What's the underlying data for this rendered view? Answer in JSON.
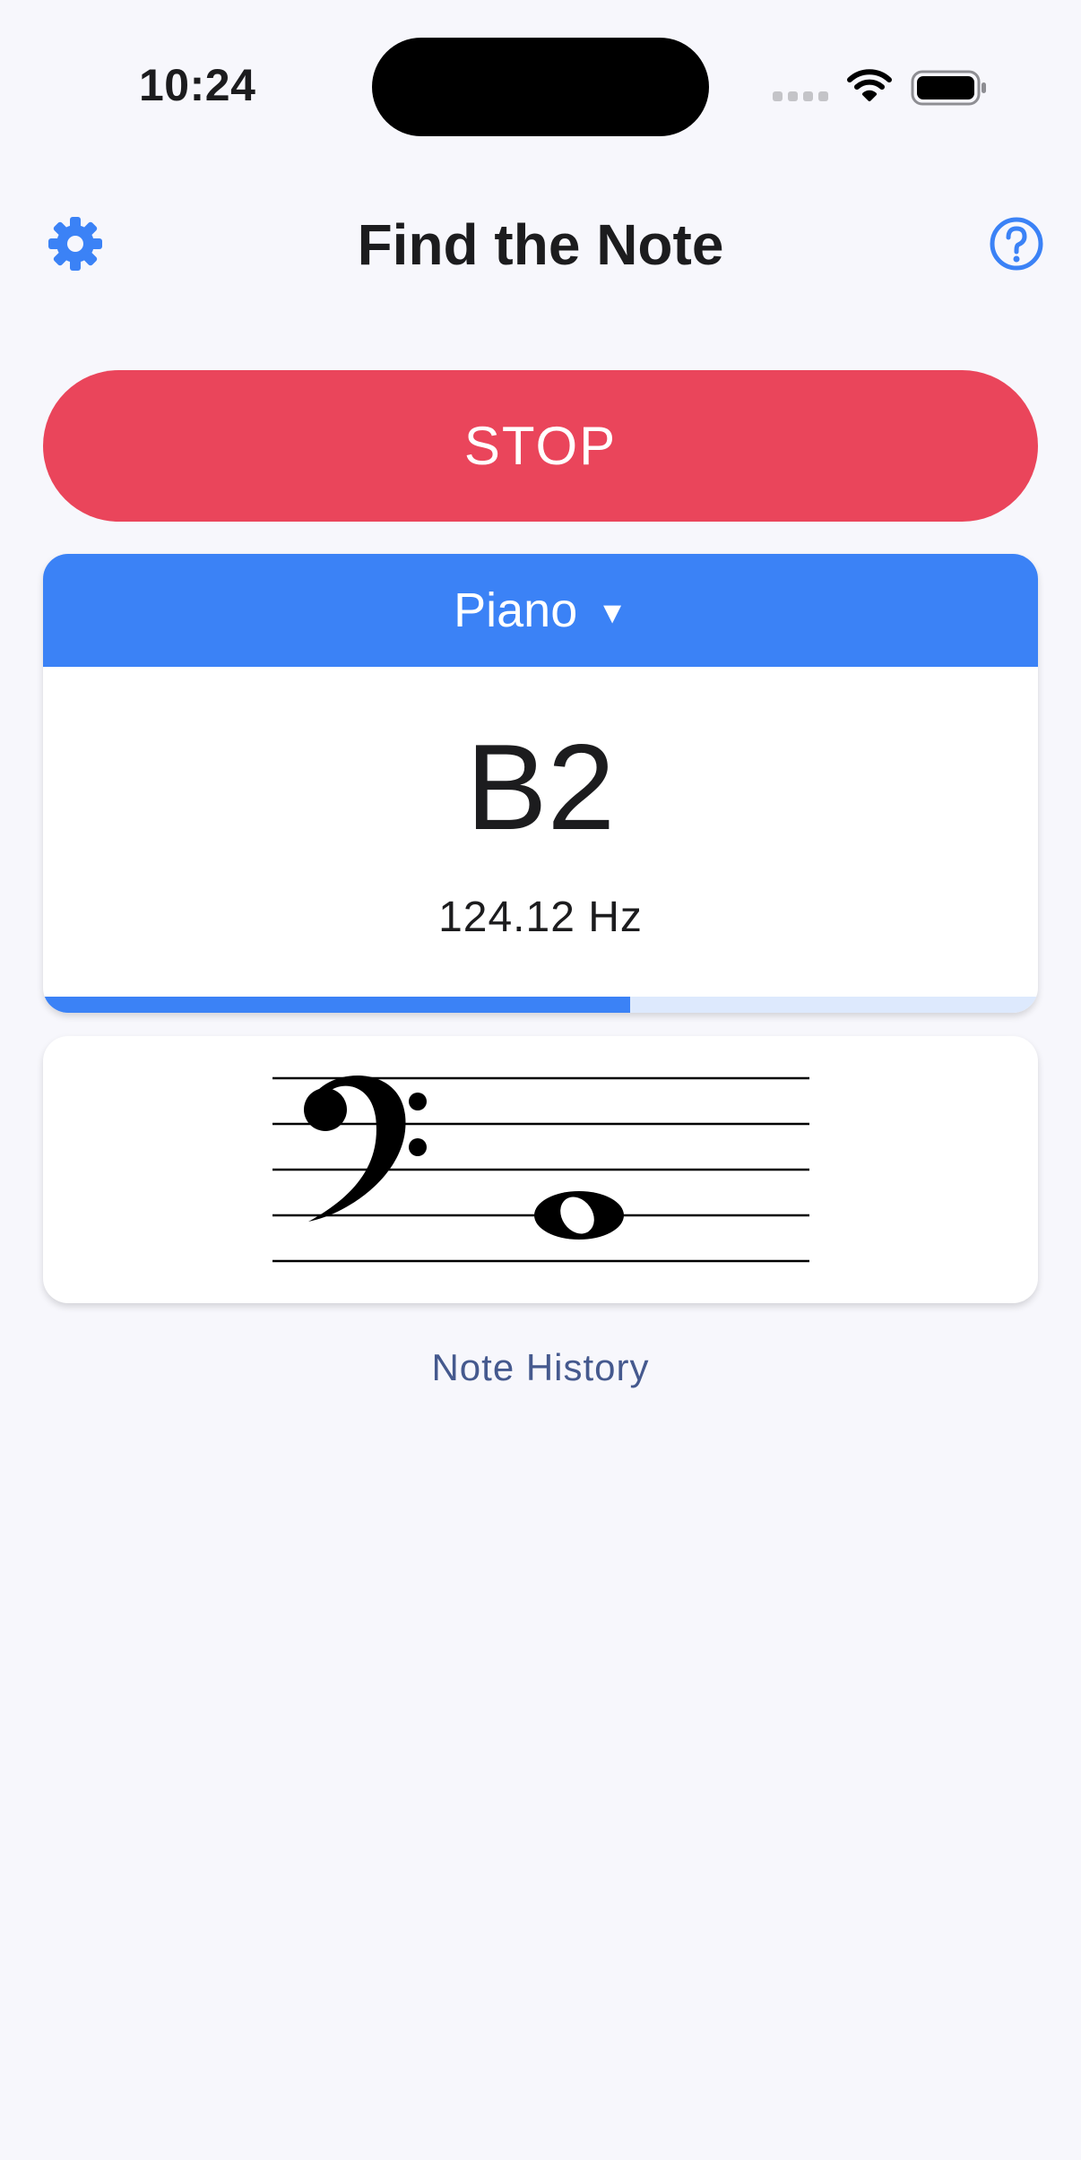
{
  "status_bar": {
    "time": "10:24"
  },
  "header": {
    "title": "Find the Note"
  },
  "controls": {
    "stop_label": "STOP"
  },
  "note_card": {
    "instrument": "Piano",
    "note": "B2",
    "frequency": "124.12 Hz",
    "progress": 0.59
  },
  "staff": {
    "clef": "bass",
    "note": "B2",
    "note_type": "whole"
  },
  "footer": {
    "history_label": "Note History"
  },
  "colors": {
    "accent": "#3b82f6",
    "stop": "#ea455b",
    "background": "#f7f7fc",
    "link": "#45598e"
  }
}
